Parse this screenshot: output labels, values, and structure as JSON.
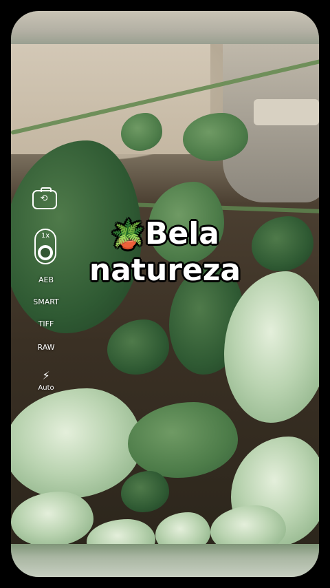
{
  "caption": {
    "emoji": "🪴",
    "line1": "Bela",
    "line2": "natureza"
  },
  "camera": {
    "flip_icon": "camera-flip-icon",
    "zoom_label": "1x",
    "modes": [
      "AEB",
      "SMART",
      "TIFF",
      "RAW"
    ],
    "flash_icon": "lightning-icon",
    "flash_label": "Auto"
  },
  "colors": {
    "leaf_dark": "#2f5a33",
    "leaf_pale": "#b9d3b0",
    "background": "#000000"
  }
}
